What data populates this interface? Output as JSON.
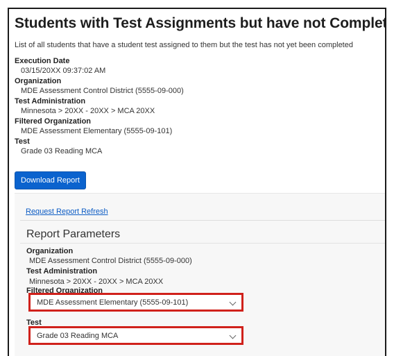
{
  "report": {
    "title": "Students with Test Assignments but have not Completed",
    "description": "List of all students that have a student test assigned to them but the test has not yet been completed",
    "execution_date_label": "Execution Date",
    "execution_date": "03/15/20XX 09:37:02 AM",
    "organization_label": "Organization",
    "organization": "MDE Assessment Control District (5555-09-000)",
    "test_administration_label": "Test Administration",
    "test_administration": "Minnesota > 20XX - 20XX > MCA 20XX",
    "filtered_organization_label": "Filtered Organization",
    "filtered_organization": "MDE Assessment Elementary (5555-09-101)",
    "test_label": "Test",
    "test": "Grade 03 Reading MCA"
  },
  "actions": {
    "download_label": "Download Report",
    "refresh_label": "Request Report Refresh"
  },
  "parameters": {
    "heading": "Report Parameters",
    "organization_label": "Organization",
    "organization": "MDE Assessment Control District (5555-09-000)",
    "test_administration_label": "Test Administration",
    "test_administration": "Minnesota > 20XX - 20XX > MCA 20XX",
    "filtered_organization_label": "Filtered Organization",
    "filtered_organization_selected": "MDE Assessment Elementary (5555-09-101)",
    "test_label": "Test",
    "test_selected": "Grade 03 Reading MCA"
  },
  "colors": {
    "primary_button": "#0b63ce",
    "link": "#0b5bc4",
    "highlight_border": "#d0211b"
  },
  "icons": [
    "chevron-down-icon"
  ]
}
